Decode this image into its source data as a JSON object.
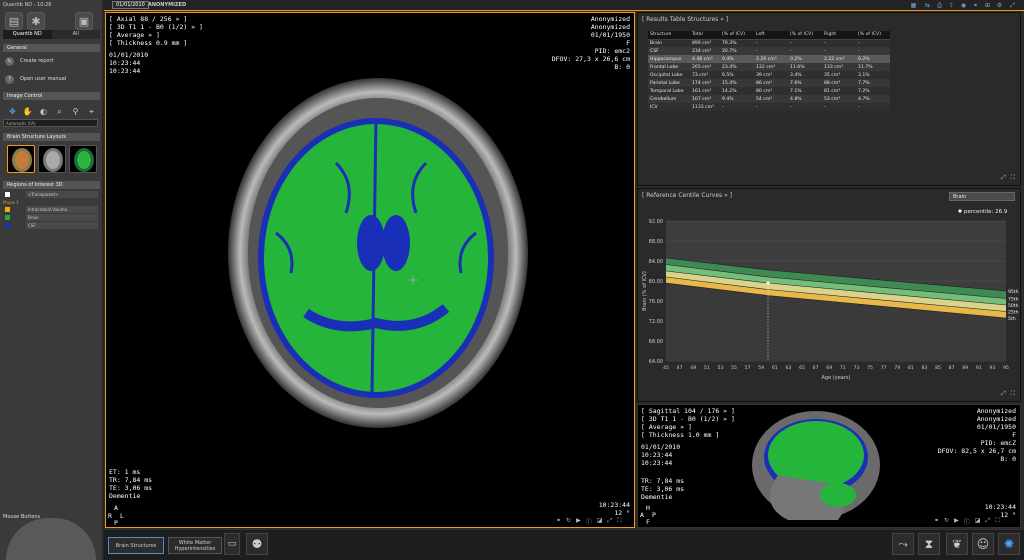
{
  "app": {
    "title": "Quantib ND - 10:26",
    "tab_quantib": "Quantib ND",
    "tab_all": "All"
  },
  "sidebar": {
    "general_header": "General",
    "general_items": [
      "Create report",
      "Open user manual"
    ],
    "image_control_header": "Image Control",
    "auto_select": "Automatic (FA)",
    "layouts_header": "Brain Structure Layouts",
    "roi_header": "Regions of Interest 3D",
    "roi_transparent": "<Transparent>",
    "phase_label": "Phase 1",
    "roi_items": [
      {
        "label": "Intracranial Volume",
        "color": "#e8b000"
      },
      {
        "label": "Brain",
        "color": "#1fb03a"
      },
      {
        "label": "CSF",
        "color": "#1a2fb8"
      }
    ],
    "mouse_header": "Mouse Buttons"
  },
  "topbar": {
    "date": "01/01/2010",
    "anonymized": "ANONYMIZED"
  },
  "viewer": {
    "tl": [
      "[ Axial 88 / 256 » ]",
      "[ 3D T1 1 - B0 (1/2) » ]",
      "[ Average » ]",
      "[ Thickness 0.9 mm ]"
    ],
    "tl2": [
      "01/01/2010",
      "10:23:44",
      "10:23:44"
    ],
    "tr": [
      "Anonymized",
      "Anonymized",
      "01/01/1950",
      "F",
      "PID: emc2",
      "DFOV: 27,3 x 26,6 cm",
      "B: 0"
    ],
    "bl": [
      "ET: 1 ms",
      "TR: 7,84 ms",
      "TE: 3,06 ms",
      "Dementie"
    ],
    "orient": [
      "A",
      "R",
      "L",
      "P"
    ],
    "br": [
      "10:23:44",
      "12 °"
    ]
  },
  "results": {
    "title": "[ Results Table Structures » ]",
    "headers": [
      "Structure",
      "Total",
      "(% of ICV)",
      "Left",
      "(% of ICV)",
      "Right",
      "(% of ICV)"
    ],
    "rows": [
      [
        "Brain",
        "899 cm³",
        "79.3%",
        "-",
        "-",
        "-",
        "-"
      ],
      [
        "CSF",
        "234 cm³",
        "20.7%",
        "-",
        "-",
        "-",
        "-"
      ],
      [
        "Hippocampus",
        "4.48 cm³",
        "0.4%",
        "2.26 cm³",
        "0.2%",
        "2.22 cm³",
        "0.2%"
      ],
      [
        "Frontal Lobe",
        "265 cm³",
        "23.4%",
        "132 cm³",
        "11.6%",
        "133 cm³",
        "11.7%"
      ],
      [
        "Occipital Lobe",
        "73 cm³",
        "6.5%",
        "39 cm³",
        "3.4%",
        "35 cm³",
        "3.1%"
      ],
      [
        "Parietal Lobe",
        "174 cm³",
        "15.4%",
        "86 cm³",
        "7.6%",
        "88 cm³",
        "7.7%"
      ],
      [
        "Temporal Lobe",
        "161 cm³",
        "14.2%",
        "80 cm³",
        "7.1%",
        "81 cm³",
        "7.2%"
      ],
      [
        "Cerebellum",
        "107 cm³",
        "9.4%",
        "54 cm³",
        "4.8%",
        "53 cm³",
        "4.7%"
      ],
      [
        "ICV",
        "1133 cm³",
        "-",
        "-",
        "-",
        "-",
        "-"
      ]
    ]
  },
  "curves": {
    "title": "[ Reference Centile Curves » ]",
    "selected": "Brain",
    "percentile_label": "percentile: 26.9"
  },
  "chart_data": {
    "type": "area",
    "x": [
      45,
      95
    ],
    "xticks": [
      45,
      47,
      49,
      51,
      53,
      55,
      57,
      59,
      61,
      63,
      65,
      67,
      69,
      71,
      73,
      75,
      77,
      79,
      81,
      83,
      85,
      87,
      89,
      91,
      93,
      95
    ],
    "yticks": [
      64.0,
      68.0,
      72.0,
      76.0,
      80.0,
      84.0,
      88.0,
      92.0
    ],
    "ylim": [
      64,
      92
    ],
    "xlim": [
      45,
      95
    ],
    "xlabel": "Age (years)",
    "ylabel": "Brain (% of ICV)",
    "series": [
      {
        "name": "95th",
        "values": [
          84.6,
          82.2,
          78.0
        ],
        "color": "#3f8a52"
      },
      {
        "name": "75th",
        "values": [
          83.3,
          80.8,
          76.5
        ],
        "color": "#75bd7a"
      },
      {
        "name": "50th",
        "values": [
          82.0,
          79.6,
          75.2
        ],
        "color": "#d9d48a"
      },
      {
        "name": "25th",
        "values": [
          80.8,
          78.3,
          73.9
        ],
        "color": "#e8b84a"
      },
      {
        "name": "5th",
        "values": [
          79.6,
          77.1,
          72.6
        ],
        "color": "#3a3a3a"
      }
    ],
    "series_x": [
      45,
      60,
      95
    ],
    "marker": {
      "x": 60,
      "y": 79.6
    }
  },
  "sagittal": {
    "tl": [
      "[ Sagittal 104 / 176 » ]",
      "[ 3D T1 1 - B0 (1/2) » ]",
      "[ Average » ]",
      "[ Thickness 1.0 mm ]"
    ],
    "tl2": [
      "01/01/2010",
      "10:23:44",
      "10:23:44"
    ],
    "tr": [
      "Anonymized",
      "Anonymized",
      "01/01/1950",
      "F",
      "PID: emcZ",
      "DFOV: 82,5 x 26,7 cm",
      "B: 0"
    ],
    "bl": [
      "TR: 7,84 ms",
      "TE: 3,06 ms",
      "Dementie"
    ],
    "orient": [
      "H",
      "A",
      "P",
      "F"
    ],
    "br": [
      "10:23:44",
      "12 °"
    ]
  },
  "bottombar": {
    "btn1": "Brain Structures",
    "btn2": "White Matter Hyperintensities"
  }
}
